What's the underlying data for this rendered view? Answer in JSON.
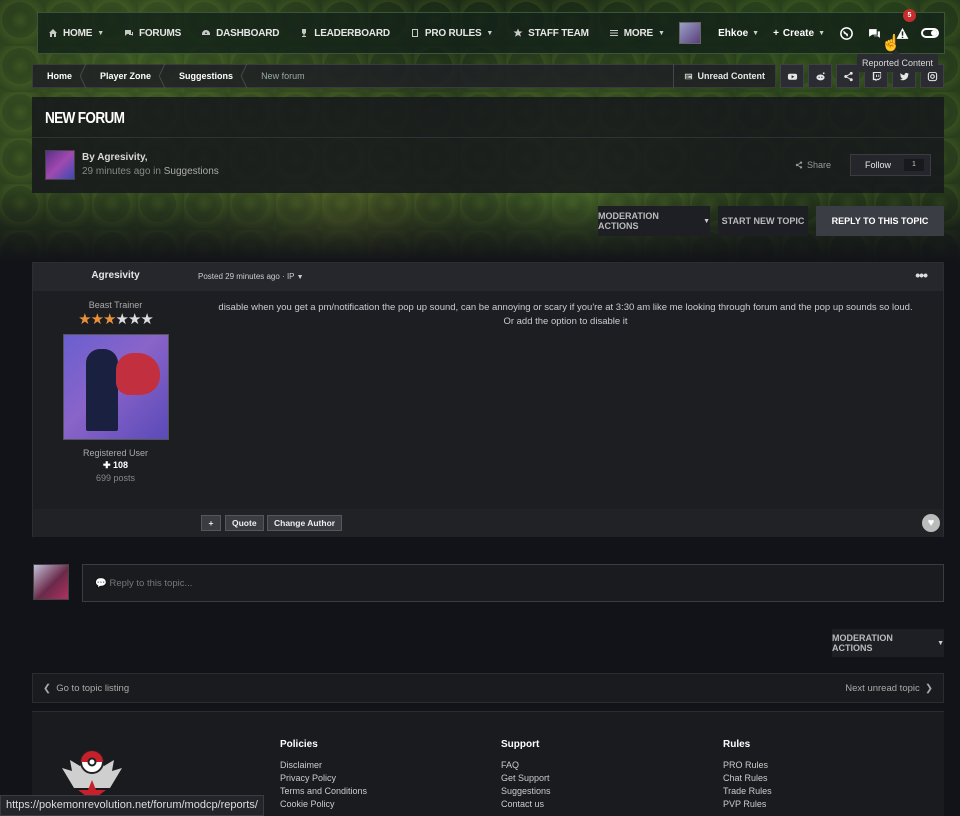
{
  "nav": {
    "items": [
      {
        "label": "Home",
        "icon": "home-icon",
        "dropdown": true
      },
      {
        "label": "Forums",
        "icon": "chat-icon",
        "dropdown": false
      },
      {
        "label": "Dashboard",
        "icon": "dashboard-icon",
        "dropdown": false
      },
      {
        "label": "Leaderboard",
        "icon": "trophy-icon",
        "dropdown": false
      },
      {
        "label": "PRO Rules",
        "icon": "book-icon",
        "dropdown": true
      },
      {
        "label": "Staff Team",
        "icon": "star-icon",
        "dropdown": false
      },
      {
        "label": "More",
        "icon": "menu-icon",
        "dropdown": true
      }
    ],
    "user": "Ehkoe",
    "create_label": "Create",
    "notif_count": "5"
  },
  "tooltip": "Reported Content",
  "breadcrumb": {
    "items": [
      "Home",
      "Player Zone",
      "Suggestions"
    ],
    "current": "New forum",
    "unread_label": "Unread Content"
  },
  "social": [
    "youtube-icon",
    "reddit-icon",
    "share-icon",
    "twitch-icon",
    "twitter-icon",
    "instagram-icon"
  ],
  "topic": {
    "title": "New forum",
    "by": "By Agresivity,",
    "meta_time": "29 minutes ago in ",
    "meta_forum": "Suggestions",
    "share_label": "Share",
    "follow_label": "Follow",
    "follow_count": "1"
  },
  "actions": {
    "moderation": "Moderation Actions",
    "start_new": "Start new topic",
    "reply": "Reply to this topic"
  },
  "post": {
    "author": "Agresivity",
    "posted": "Posted 29 minutes ago · IP",
    "rank_title": "Beast Trainer",
    "stars_on": 3,
    "stars_total": 6,
    "group": "Registered User",
    "reputation": "108",
    "post_count": "699 posts",
    "body_line1": "disable when you get a pm/notification the pop up sound, can be annoying or scary if you're at 3:30 am like me looking through forum and the pop up sounds so loud.",
    "body_line2": "Or add the option to disable it",
    "btn_plus": "+",
    "btn_quote": "Quote",
    "btn_change_author": "Change Author"
  },
  "reply": {
    "placeholder": "Reply to this topic..."
  },
  "moderation_bottom": "Moderation Actions",
  "pager": {
    "prev": "Go to topic listing",
    "next": "Next unread topic"
  },
  "footer": {
    "columns": [
      {
        "title": "Policies",
        "links": [
          "Disclaimer",
          "Privacy Policy",
          "Terms and Conditions",
          "Cookie Policy"
        ]
      },
      {
        "title": "Support",
        "links": [
          "FAQ",
          "Get Support",
          "Suggestions",
          "Contact us"
        ]
      },
      {
        "title": "Rules",
        "links": [
          "PRO Rules",
          "Chat Rules",
          "Trade Rules",
          "PVP Rules"
        ]
      }
    ]
  },
  "status_url": "https://pokemonrevolution.net/forum/modcp/reports/",
  "colors": {
    "accent": "#e8913a",
    "badge": "#c72d2d",
    "panel": "#1c1e22"
  }
}
